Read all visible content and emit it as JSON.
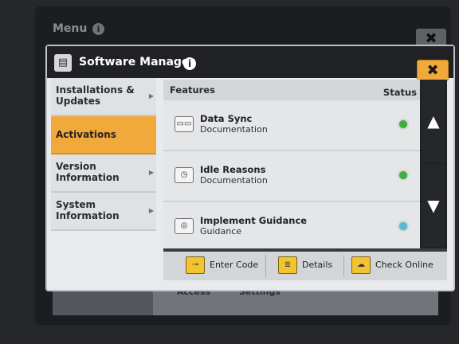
{
  "background": {
    "title": "Menu",
    "info_glyph": "i",
    "close_glyph": "✖",
    "lower_labels": [
      "Access",
      "Settings"
    ]
  },
  "dialog": {
    "title": "Software Manager",
    "info_glyph": "i",
    "close_glyph": "✖",
    "icon": "software-manager-icon"
  },
  "nav": {
    "items": [
      {
        "label": "Installations & Updates",
        "active": false
      },
      {
        "label": "Activations",
        "active": true
      },
      {
        "label": "Version Information",
        "active": false
      },
      {
        "label": "System Information",
        "active": false
      }
    ]
  },
  "features": {
    "header_label": "Features",
    "status_label": "Status",
    "rows": [
      {
        "name": "Data Sync",
        "sub": "Documentation",
        "icon": "data-sync-icon",
        "status_color": "#3fae3b"
      },
      {
        "name": "Idle Reasons",
        "sub": "Documentation",
        "icon": "clock-icon",
        "status_color": "#3fae3b"
      },
      {
        "name": "Implement Guidance",
        "sub": "Guidance",
        "icon": "guidance-icon",
        "status_color": "#5bb8d6"
      }
    ]
  },
  "actions": {
    "enter_code": "Enter Code",
    "details": "Details",
    "check_online": "Check Online"
  },
  "colors": {
    "accent": "#f2a93b",
    "status_active": "#3fae3b",
    "status_info": "#5bb8d6"
  }
}
